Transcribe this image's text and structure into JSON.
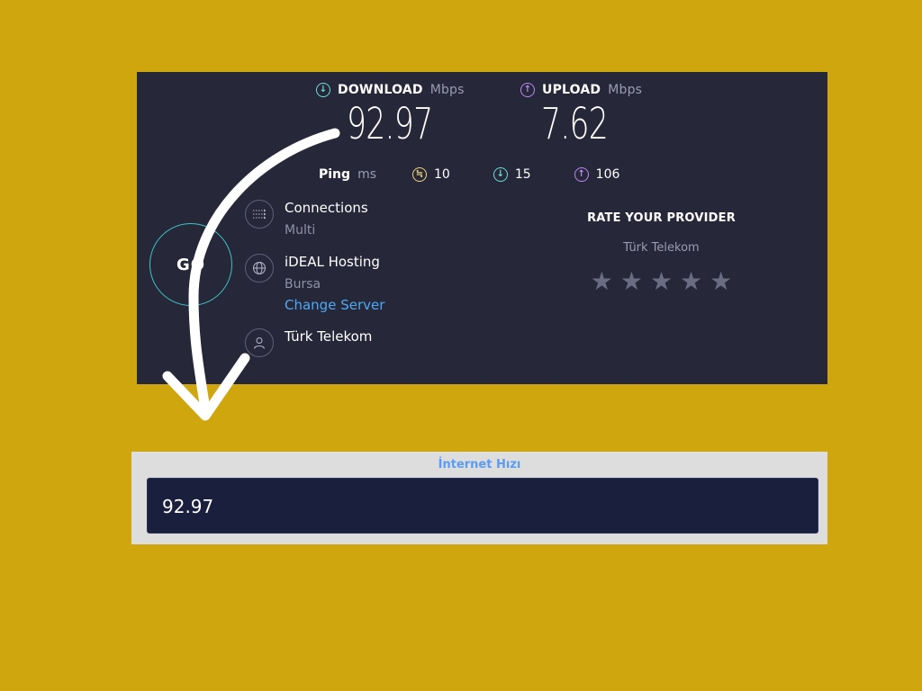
{
  "speedtest": {
    "download": {
      "label": "DOWNLOAD",
      "unit": "Mbps",
      "value": "92.97"
    },
    "upload": {
      "label": "UPLOAD",
      "unit": "Mbps",
      "value": "7.62"
    },
    "ping": {
      "label": "Ping",
      "unit": "ms",
      "idle": "10",
      "download": "15",
      "upload": "106"
    },
    "go_label": "GO",
    "connections": {
      "title": "Connections",
      "value": "Multi"
    },
    "server": {
      "title": "iDEAL Hosting",
      "location": "Bursa",
      "change_label": "Change Server"
    },
    "isp": {
      "name": "Türk Telekom"
    },
    "rate": {
      "title": "RATE YOUR PROVIDER",
      "provider": "Türk Telekom",
      "stars": 0,
      "max_stars": 5
    }
  },
  "result": {
    "label": "İnternet Hızı",
    "value": "92.97"
  },
  "colors": {
    "background": "#cfa60d",
    "panel": "#262739",
    "download_accent": "#6ee0d2",
    "upload_accent": "#b98bf0",
    "link": "#4fa9f2",
    "result_field": "#1a1f3d"
  },
  "icons": {
    "download": "arrow-down-circle-icon",
    "upload": "arrow-up-circle-icon",
    "jitter": "jitter-icon",
    "connections": "connections-icon",
    "server": "globe-icon",
    "isp": "user-icon",
    "overlay_arrow": "curved-arrow-icon"
  }
}
